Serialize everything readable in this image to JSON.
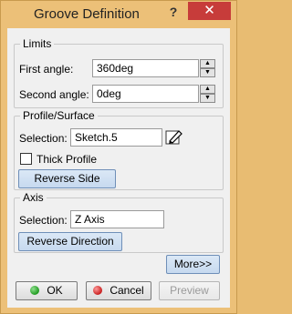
{
  "window": {
    "title": "Groove Definition",
    "help_label": "?",
    "close_label": "✕"
  },
  "limits": {
    "legend": "Limits",
    "first_angle_label": "First angle:",
    "first_angle_value": "360deg",
    "second_angle_label": "Second angle:",
    "second_angle_value": "0deg"
  },
  "profile": {
    "legend": "Profile/Surface",
    "selection_label": "Selection:",
    "selection_value": "Sketch.5",
    "thick_profile_label": "Thick Profile",
    "thick_profile_checked": false,
    "reverse_side_label": "Reverse Side"
  },
  "axis": {
    "legend": "Axis",
    "selection_label": "Selection:",
    "selection_value": "Z Axis",
    "reverse_direction_label": "Reverse Direction"
  },
  "footer": {
    "more_label": "More>>",
    "ok_label": "OK",
    "cancel_label": "Cancel",
    "preview_label": "Preview"
  },
  "icons": {
    "edit": "pencil-edit-icon",
    "ok": "green-dot-icon",
    "cancel": "red-dot-icon"
  }
}
